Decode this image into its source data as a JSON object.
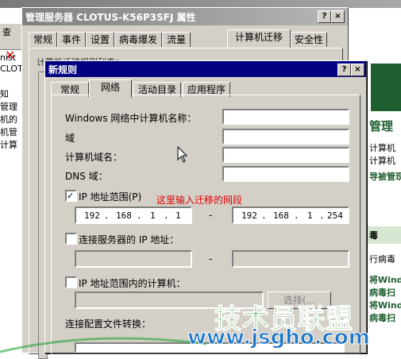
{
  "background": {
    "left_texts": [
      "查",
      "nist",
      "CLOT",
      "知",
      "管理",
      "机的",
      "机管",
      "计算"
    ],
    "left_toolbar_icon": "close-x-icon",
    "right_texts": [
      "管理",
      "计算机",
      "计算机",
      "导被管现",
      "毒",
      "行病毒",
      "将Windo",
      "病毒扫",
      "将Windo",
      "病毒扫"
    ]
  },
  "outer_dialog": {
    "title": "管理服务器 CLOTUS-K56P3SFJ 属性",
    "help_label": "?",
    "close_label": "×",
    "tabs": [
      "常规",
      "事件",
      "设置",
      "病毒爆发",
      "流量",
      "计算机迁移",
      "安全性"
    ],
    "active_tab": "计算机迁移",
    "partial_label": "计算机迁移规则列表："
  },
  "inner_dialog": {
    "title": "新规则",
    "help_label": "?",
    "close_label": "×",
    "tabs": [
      "常规",
      "网络",
      "活动目录",
      "应用程序"
    ],
    "active_tab": "网络",
    "labels": {
      "windows_name": "Windows 网络中计算机名称：",
      "domain": "域",
      "computer_domain": "计算机域名：",
      "dns_domain": "DNS 域："
    },
    "ip_range": {
      "checkbox_label": "IP 地址范围(P)",
      "checked": true,
      "annotation": "这里输入迁移的网段",
      "from": [
        "192",
        "168",
        "1",
        "1"
      ],
      "to": [
        "192",
        "168",
        "1",
        "254"
      ],
      "separator": "-"
    },
    "server_ip": {
      "checkbox_label": "连接服务器的 IP 地址：",
      "checked": false,
      "separator": "-"
    },
    "ip_computers": {
      "checkbox_label": "IP 地址范围内的计算机：",
      "checked": false,
      "select_button": "选择(..."
    },
    "profile_label": "连接配置文件转换："
  },
  "watermark": {
    "brand": "技术员联盟",
    "url": "www.jsgho.com"
  },
  "colors": {
    "active_title": "#000080",
    "inactive_title": "#808080",
    "dialog_face": "#d4d0c8",
    "annotation": "#e00000",
    "watermark_green": "#2aa33a",
    "watermark_blue": "#1f78c8"
  }
}
